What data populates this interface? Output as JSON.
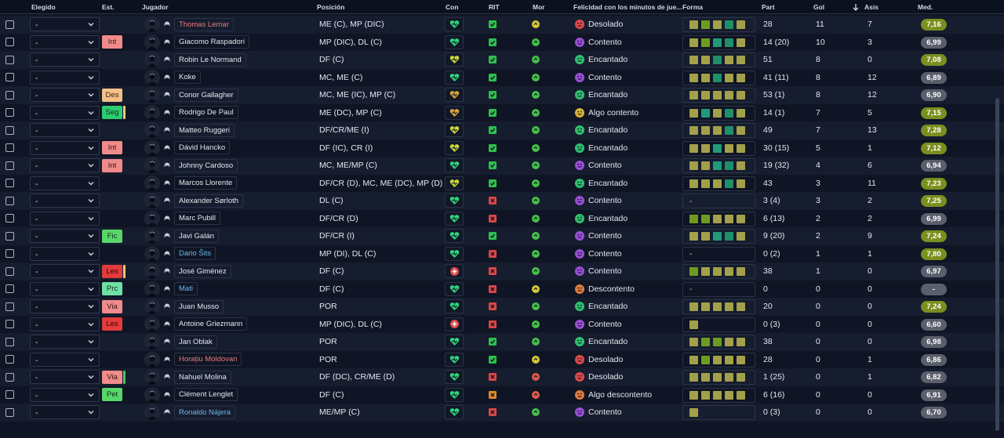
{
  "columns": {
    "elegido": "Elegido",
    "est": "Est.",
    "jugador": "Jugador",
    "posicion": "Posición",
    "con": "Con",
    "rit": "RIT",
    "mor": "Mor",
    "felicidad": "Felicidad con los minutos de jue...",
    "forma": "Forma",
    "part": "Part",
    "gol": "Gol",
    "asis": "Asis",
    "med": "Med."
  },
  "sort": {
    "icon": "arrow-down-icon",
    "column": "Asis"
  },
  "colors": {
    "accent_med": "#7a8f1f",
    "neutral_med": "#5a5f6b",
    "happy": "#2fbf6e",
    "content": "#9a4fd6",
    "sad": "#e04848",
    "warn": "#e09a2a"
  },
  "badge_colors": {
    "Int": {
      "bg": "#f08b8b",
      "fg": "#3a1010"
    },
    "Des": {
      "bg": "#f4c08a",
      "fg": "#3a2410"
    },
    "Seg": {
      "bg": "#2ecc71",
      "fg": "#0d2a18"
    },
    "Fic": {
      "bg": "#58d66a",
      "fg": "#0f2a14"
    },
    "Les": {
      "bg": "#e23b3b",
      "fg": "#2a0808"
    },
    "Prc": {
      "bg": "#6fe0a4",
      "fg": "#0f2a1c"
    },
    "Via": {
      "bg": "#f08b8b",
      "fg": "#3a1010"
    },
    "Pet": {
      "bg": "#58d66a",
      "fg": "#0f2a14"
    }
  },
  "rows": [
    {
      "select": "-",
      "est": "",
      "bar": "",
      "name": "Thomas Lemar",
      "name_color": "red",
      "pos": "ME (C), MP (DIC)",
      "con": "green",
      "rit": "green",
      "mor": "yellow",
      "fel": "Desolado",
      "fel_mood": "sad",
      "form": [
        "o",
        "l",
        "o",
        "g",
        "o"
      ],
      "part": "28",
      "gol": "11",
      "asis": "7",
      "med": "7,16",
      "med_hi": true
    },
    {
      "select": "-",
      "est": "Int",
      "bar": "",
      "name": "Giacomo Raspadori",
      "name_color": "white",
      "pos": "MP (DIC), DL (C)",
      "con": "green",
      "rit": "green",
      "mor": "green",
      "fel": "Contento",
      "fel_mood": "content",
      "form": [
        "o",
        "l",
        "t",
        "g",
        "o"
      ],
      "part": "14 (20)",
      "gol": "10",
      "asis": "3",
      "med": "6,99",
      "med_hi": false
    },
    {
      "select": "-",
      "est": "",
      "bar": "",
      "name": "Robin Le Normand",
      "name_color": "white",
      "pos": "DF (C)",
      "con": "yellow",
      "rit": "green",
      "mor": "green",
      "fel": "Encantado",
      "fel_mood": "happy",
      "form": [
        "o",
        "o",
        "g",
        "o",
        "o"
      ],
      "part": "51",
      "gol": "8",
      "asis": "0",
      "med": "7,08",
      "med_hi": true
    },
    {
      "select": "-",
      "est": "",
      "bar": "",
      "name": "Koke",
      "name_color": "white",
      "pos": "MC, ME (C)",
      "con": "green",
      "rit": "green",
      "mor": "green",
      "fel": "Contento",
      "fel_mood": "content",
      "form": [
        "o",
        "o",
        "g",
        "o",
        "o"
      ],
      "part": "41 (11)",
      "gol": "8",
      "asis": "12",
      "med": "6,89",
      "med_hi": false
    },
    {
      "select": "-",
      "est": "Des",
      "bar": "",
      "name": "Conor Gallagher",
      "name_color": "white",
      "pos": "MC, ME (IC), MP (C)",
      "con": "orange",
      "rit": "green",
      "mor": "green",
      "fel": "Encantado",
      "fel_mood": "happy",
      "form": [
        "o",
        "o",
        "o",
        "o",
        "o"
      ],
      "part": "53 (1)",
      "gol": "8",
      "asis": "12",
      "med": "6,90",
      "med_hi": false
    },
    {
      "select": "-",
      "est": "Seg",
      "bar": "yellow",
      "name": "Rodrigo De Paul",
      "name_color": "white",
      "pos": "ME (DC), MP (C)",
      "con": "orange",
      "rit": "green",
      "mor": "green",
      "fel": "Algo contento",
      "fel_mood": "meh",
      "form": [
        "o",
        "t",
        "o",
        "g",
        "o"
      ],
      "part": "14 (1)",
      "gol": "7",
      "asis": "5",
      "med": "7,15",
      "med_hi": true
    },
    {
      "select": "-",
      "est": "",
      "bar": "",
      "name": "Matteo Ruggeri",
      "name_color": "white",
      "pos": "DF/CR/ME (I)",
      "con": "yellow",
      "rit": "green",
      "mor": "green",
      "fel": "Encantado",
      "fel_mood": "happy",
      "form": [
        "o",
        "o",
        "o",
        "g",
        "o"
      ],
      "part": "49",
      "gol": "7",
      "asis": "13",
      "med": "7,28",
      "med_hi": true
    },
    {
      "select": "-",
      "est": "Int",
      "bar": "",
      "name": "Dávid Hancko",
      "name_color": "white",
      "pos": "DF (IC), CR (I)",
      "con": "yellow",
      "rit": "green",
      "mor": "green",
      "fel": "Encantado",
      "fel_mood": "happy",
      "form": [
        "o",
        "o",
        "t",
        "o",
        "o"
      ],
      "part": "30 (15)",
      "gol": "5",
      "asis": "1",
      "med": "7,12",
      "med_hi": true
    },
    {
      "select": "-",
      "est": "Int",
      "bar": "",
      "name": "Johnny Cardoso",
      "name_color": "white",
      "pos": "MC, ME/MP (C)",
      "con": "green",
      "rit": "green",
      "mor": "green",
      "fel": "Contento",
      "fel_mood": "content",
      "form": [
        "o",
        "o",
        "t",
        "g",
        "o"
      ],
      "part": "19 (32)",
      "gol": "4",
      "asis": "6",
      "med": "6,94",
      "med_hi": false
    },
    {
      "select": "-",
      "est": "",
      "bar": "",
      "name": "Marcos Llorente",
      "name_color": "white",
      "pos": "DF/CR (D), MC, ME (DC), MP (D)",
      "con": "yellow",
      "rit": "green",
      "mor": "green",
      "fel": "Encantado",
      "fel_mood": "happy",
      "form": [
        "o",
        "o",
        "o",
        "g",
        "o"
      ],
      "part": "43",
      "gol": "3",
      "asis": "11",
      "med": "7,23",
      "med_hi": true
    },
    {
      "select": "-",
      "est": "",
      "bar": "",
      "name": "Alexander Sørloth",
      "name_color": "white",
      "pos": "DL (C)",
      "con": "green",
      "rit": "red",
      "mor": "green",
      "fel": "Contento",
      "fel_mood": "content",
      "form": [],
      "part": "3 (4)",
      "gol": "3",
      "asis": "2",
      "med": "7,25",
      "med_hi": true
    },
    {
      "select": "-",
      "est": "",
      "bar": "",
      "name": "Marc Pubill",
      "name_color": "white",
      "pos": "DF/CR (D)",
      "con": "green",
      "rit": "red",
      "mor": "green",
      "fel": "Encantado",
      "fel_mood": "happy",
      "form": [
        "l",
        "l",
        "o",
        "o",
        "o"
      ],
      "part": "6 (13)",
      "gol": "2",
      "asis": "2",
      "med": "6,99",
      "med_hi": false
    },
    {
      "select": "-",
      "est": "Fic",
      "bar": "",
      "name": "Javi Galán",
      "name_color": "white",
      "pos": "DF/CR (I)",
      "con": "green",
      "rit": "green",
      "mor": "green",
      "fel": "Contento",
      "fel_mood": "content",
      "form": [
        "o",
        "o",
        "t",
        "g",
        "o"
      ],
      "part": "9 (20)",
      "gol": "2",
      "asis": "9",
      "med": "7,24",
      "med_hi": true
    },
    {
      "select": "-",
      "est": "",
      "bar": "",
      "name": "Dario Šits",
      "name_color": "blue",
      "pos": "MP (DI), DL (C)",
      "con": "green",
      "rit": "red",
      "mor": "green",
      "fel": "Contento",
      "fel_mood": "content",
      "form": [],
      "part": "0 (2)",
      "gol": "1",
      "asis": "1",
      "med": "7,80",
      "med_hi": true
    },
    {
      "select": "-",
      "est": "Les",
      "bar": "yellow",
      "name": "José Giménez",
      "name_color": "white",
      "pos": "DF (C)",
      "con": "injury",
      "rit": "red",
      "mor": "green",
      "fel": "Contento",
      "fel_mood": "content",
      "form": [
        "l",
        "o",
        "o",
        "o",
        "o"
      ],
      "part": "38",
      "gol": "1",
      "asis": "0",
      "med": "6,97",
      "med_hi": false
    },
    {
      "select": "-",
      "est": "Prc",
      "bar": "",
      "name": "Mati",
      "name_color": "blue",
      "pos": "DF (C)",
      "con": "green",
      "rit": "red",
      "mor": "yellow",
      "fel": "Descontento",
      "fel_mood": "warn",
      "form": [],
      "part": "0",
      "gol": "0",
      "asis": "0",
      "med": "-",
      "med_hi": false
    },
    {
      "select": "-",
      "est": "Via",
      "bar": "",
      "name": "Juan Musso",
      "name_color": "white",
      "pos": "POR",
      "con": "green",
      "rit": "red",
      "mor": "green",
      "fel": "Encantado",
      "fel_mood": "happy",
      "form": [
        "o",
        "o",
        "o",
        "o",
        "o"
      ],
      "part": "20",
      "gol": "0",
      "asis": "0",
      "med": "7,24",
      "med_hi": true
    },
    {
      "select": "-",
      "est": "Les",
      "bar": "",
      "name": "Antoine Griezmann",
      "name_color": "white",
      "pos": "MP (DIC), DL (C)",
      "con": "injury",
      "rit": "red",
      "mor": "green",
      "fel": "Contento",
      "fel_mood": "content",
      "form": [
        "o"
      ],
      "part": "0 (3)",
      "gol": "0",
      "asis": "0",
      "med": "6,60",
      "med_hi": false
    },
    {
      "select": "-",
      "est": "",
      "bar": "",
      "name": "Jan Oblak",
      "name_color": "white",
      "pos": "POR",
      "con": "green",
      "rit": "green",
      "mor": "green",
      "fel": "Encantado",
      "fel_mood": "happy",
      "form": [
        "o",
        "l",
        "l",
        "o",
        "o"
      ],
      "part": "38",
      "gol": "0",
      "asis": "0",
      "med": "6,98",
      "med_hi": false
    },
    {
      "select": "-",
      "est": "",
      "bar": "",
      "name": "Horațiu Moldovan",
      "name_color": "red",
      "pos": "POR",
      "con": "green",
      "rit": "green",
      "mor": "yellow",
      "fel": "Desolado",
      "fel_mood": "sad",
      "form": [
        "o",
        "l",
        "o",
        "o",
        "o"
      ],
      "part": "28",
      "gol": "0",
      "asis": "1",
      "med": "6,86",
      "med_hi": false
    },
    {
      "select": "-",
      "est": "Via",
      "bar": "green",
      "name": "Nahuel Molina",
      "name_color": "white",
      "pos": "DF (DC), CR/ME (D)",
      "con": "green",
      "rit": "red",
      "mor": "red",
      "fel": "Desolado",
      "fel_mood": "sad",
      "form": [
        "o",
        "o",
        "o",
        "o",
        "o"
      ],
      "part": "1 (25)",
      "gol": "0",
      "asis": "1",
      "med": "6,82",
      "med_hi": false
    },
    {
      "select": "-",
      "est": "Pet",
      "bar": "",
      "name": "Clément Lenglet",
      "name_color": "white",
      "pos": "DF (C)",
      "con": "green",
      "rit": "orange",
      "mor": "red",
      "fel": "Algo descontento",
      "fel_mood": "warn",
      "form": [
        "o",
        "o",
        "o",
        "o",
        "o"
      ],
      "part": "6 (16)",
      "gol": "0",
      "asis": "0",
      "med": "6,91",
      "med_hi": false
    },
    {
      "select": "-",
      "est": "",
      "bar": "",
      "name": "Ronaldo Nájera",
      "name_color": "blue",
      "pos": "ME/MP (C)",
      "con": "green",
      "rit": "red",
      "mor": "green",
      "fel": "Contento",
      "fel_mood": "content",
      "form": [
        "o"
      ],
      "part": "0 (3)",
      "gol": "0",
      "asis": "0",
      "med": "6,70",
      "med_hi": false
    }
  ]
}
